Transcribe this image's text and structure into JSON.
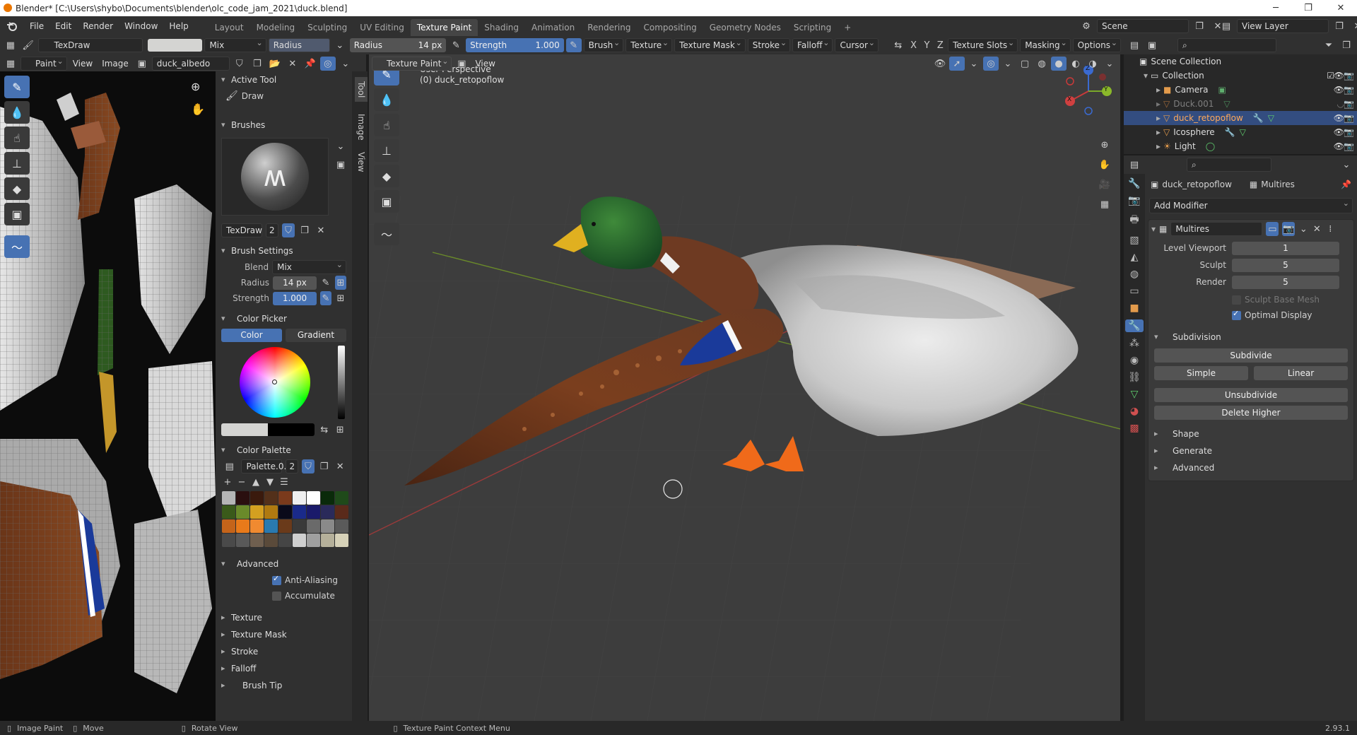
{
  "window": {
    "title": "Blender* [C:\\Users\\shybo\\Documents\\blender\\olc_code_jam_2021\\duck.blend]",
    "minimize": "─",
    "maximize": "❐",
    "close": "✕"
  },
  "menu": {
    "items": [
      "File",
      "Edit",
      "Render",
      "Window",
      "Help"
    ]
  },
  "workspaces": {
    "tabs": [
      "Layout",
      "Modeling",
      "Sculpting",
      "UV Editing",
      "Texture Paint",
      "Shading",
      "Animation",
      "Rendering",
      "Compositing",
      "Geometry Nodes",
      "Scripting"
    ],
    "active": "Texture Paint",
    "add": "+"
  },
  "scene": {
    "label": "Scene",
    "viewlayer": "View Layer"
  },
  "tool_header": {
    "brush_name": "TexDraw",
    "blend_label": "Mix",
    "radius_tab": "Radius",
    "radius_label": "Radius",
    "radius_value": "14 px",
    "strength_label": "Strength",
    "strength_value": "1.000",
    "menus": [
      "Brush",
      "Texture",
      "Texture Mask",
      "Stroke",
      "Falloff",
      "Cursor"
    ],
    "axes": [
      "X",
      "Y",
      "Z"
    ],
    "texture_slots": "Texture Slots",
    "masking": "Masking",
    "options": "Options"
  },
  "image_editor": {
    "mode": "Paint",
    "view": "View",
    "image_menu": "Image",
    "image_name": "duck_albedo"
  },
  "npanel": {
    "active_tool_title": "Active Tool",
    "tool_name": "Draw",
    "brushes_title": "Brushes",
    "brush_name": "TexDraw",
    "brush_users": "2",
    "brush_settings_title": "Brush Settings",
    "blend_label": "Blend",
    "blend_value": "Mix",
    "radius_label": "Radius",
    "radius_value": "14 px",
    "strength_label": "Strength",
    "strength_value": "1.000",
    "color_picker_title": "Color Picker",
    "color_tab": "Color",
    "gradient_tab": "Gradient",
    "palette_title": "Color Palette",
    "palette_name": "Palette.0...",
    "palette_users": "2",
    "palette_colors": [
      "#b5b5b5",
      "#2a0f0f",
      "#3a1a0d",
      "#53301a",
      "#7a3a1c",
      "#efefef",
      "#ffffff",
      "#0a2a0a",
      "#1f4a1a",
      "#3a5a1a",
      "#6a8a2a",
      "#d4a020",
      "#b07a10",
      "#0a0a1a",
      "#1a2a8a",
      "#1a1a6a",
      "#2a2a5a",
      "#5a2a1a",
      "#c4641a",
      "#e87a1a",
      "#f08a30",
      "#2a7ab0",
      "#6a3a1a",
      "#3a3a3a",
      "#6a6a6a",
      "#8a8a8a",
      "#5a5a5a",
      "#4a4a4a",
      "#595959",
      "#6f5f4f",
      "#5a4a3a",
      "#454545",
      "#cfcfcf",
      "#9f9f9f",
      "#b5b09a",
      "#d6d1b8"
    ],
    "advanced_title": "Advanced",
    "anti_aliasing": "Anti-Aliasing",
    "accumulate": "Accumulate",
    "closed_sections": [
      "Texture",
      "Texture Mask",
      "Stroke",
      "Falloff"
    ],
    "brush_tip": "Brush Tip",
    "side_tabs": [
      "Tool",
      "Image",
      "View"
    ]
  },
  "viewport": {
    "mode": "Texture Paint",
    "view": "View",
    "perspective": "User Perspective",
    "object": "(0) duck_retopoflow",
    "gizmo": {
      "x": "X",
      "y": "Y",
      "z": "Z"
    }
  },
  "outliner": {
    "root": "Scene Collection",
    "collection": "Collection",
    "items": [
      {
        "name": "Camera",
        "icon": "camera-icon"
      },
      {
        "name": "Duck.001",
        "icon": "mesh-icon"
      },
      {
        "name": "duck_retopoflow",
        "icon": "mesh-icon"
      },
      {
        "name": "Icosphere",
        "icon": "mesh-icon"
      },
      {
        "name": "Light",
        "icon": "light-icon"
      }
    ]
  },
  "properties": {
    "object_name": "duck_retopoflow",
    "modifier_tab": "Multires",
    "add_modifier": "Add Modifier",
    "modifier": {
      "name": "Multires",
      "level_viewport_label": "Level Viewport",
      "level_viewport": "1",
      "sculpt_label": "Sculpt",
      "sculpt": "5",
      "render_label": "Render",
      "render": "5",
      "sculpt_base_mesh": "Sculpt Base Mesh",
      "optimal_display": "Optimal Display",
      "subdivision_title": "Subdivision",
      "subdivide": "Subdivide",
      "simple": "Simple",
      "linear": "Linear",
      "unsubdivide": "Unsubdivide",
      "delete_higher": "Delete Higher",
      "sections": [
        "Shape",
        "Generate",
        "Advanced"
      ]
    }
  },
  "status": {
    "image_paint": "Image Paint",
    "move": "Move",
    "rotate": "Rotate View",
    "context": "Texture Paint Context Menu",
    "version": "2.93.1"
  },
  "colors": {
    "accent": "#4772b3",
    "selected_row": "#334d80"
  }
}
